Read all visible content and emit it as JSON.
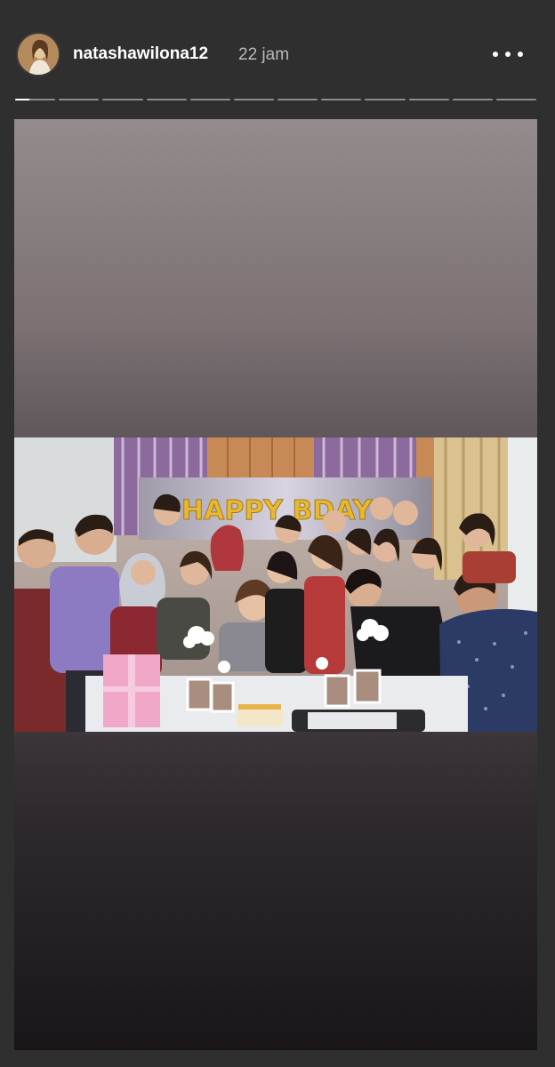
{
  "story": {
    "username": "natashawilona12",
    "time": "22 jam",
    "avatar_icon": "user-avatar",
    "menu_icon": "more-options-icon",
    "segments_total": 12,
    "segment_current": 1,
    "segment_progress": 0.35,
    "photo_banner_text": "HAPPY BDAY"
  }
}
